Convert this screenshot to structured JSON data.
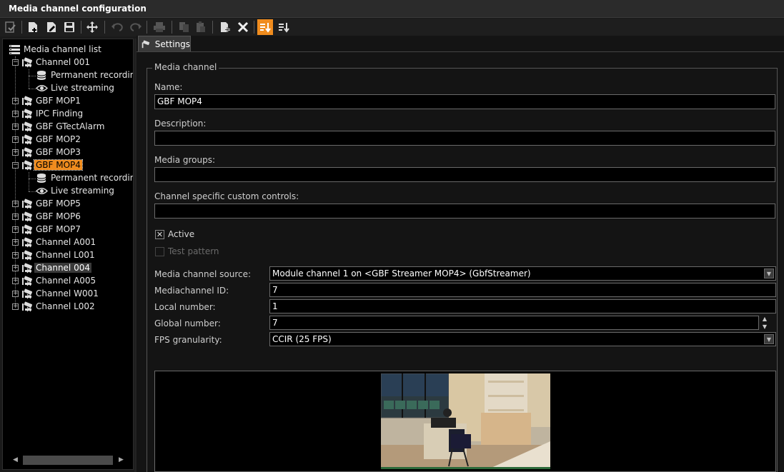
{
  "window": {
    "title": "Media channel configuration"
  },
  "toolbar": {
    "buttons": [
      {
        "icon": "check-config-icon"
      },
      {
        "icon": "new-icon"
      },
      {
        "icon": "edit-icon"
      },
      {
        "icon": "save-icon"
      },
      {
        "icon": "move-icon"
      },
      {
        "icon": "undo-icon"
      },
      {
        "icon": "redo-icon"
      },
      {
        "icon": "print-icon"
      },
      {
        "icon": "copy-icon"
      },
      {
        "icon": "paste-icon"
      },
      {
        "icon": "add-icon"
      },
      {
        "icon": "delete-icon"
      },
      {
        "icon": "sort-icon"
      },
      {
        "icon": "sort-alt-icon"
      }
    ],
    "accent": "#f08c1e"
  },
  "tree": {
    "root": "Media channel list",
    "items": [
      {
        "label": "Channel 001"
      },
      {
        "label": "Permanent recordin"
      },
      {
        "label": "Live streaming"
      },
      {
        "label": "GBF MOP1"
      },
      {
        "label": "IPC Finding"
      },
      {
        "label": "GBF GTectAlarm"
      },
      {
        "label": "GBF MOP2"
      },
      {
        "label": "GBF MOP3"
      },
      {
        "label": "GBF MOP4"
      },
      {
        "label": "Permanent recordin"
      },
      {
        "label": "Live streaming"
      },
      {
        "label": "GBF MOP5"
      },
      {
        "label": "GBF MOP6"
      },
      {
        "label": "GBF MOP7"
      },
      {
        "label": "Channel A001"
      },
      {
        "label": "Channel L001"
      },
      {
        "label": "Channel 004"
      },
      {
        "label": "Channel A005"
      },
      {
        "label": "Channel W001"
      },
      {
        "label": "Channel L002"
      }
    ],
    "selected": "GBF MOP4"
  },
  "settings": {
    "tab_label": "Settings",
    "group_title": "Media channel",
    "name_label": "Name:",
    "name_value": "GBF MOP4",
    "description_label": "Description:",
    "description_value": "",
    "media_groups_label": "Media groups:",
    "media_groups_value": "",
    "custom_controls_label": "Channel specific custom controls:",
    "custom_controls_value": "",
    "active_label": "Active",
    "active_checked": "✕",
    "test_pattern_label": "Test pattern",
    "source_label": "Media channel source:",
    "source_value": "Module channel 1 on <GBF Streamer MOP4> (GbfStreamer)",
    "id_label": "Mediachannel ID:",
    "id_value": "7",
    "local_label": "Local number:",
    "local_value": "1",
    "global_label": "Global number:",
    "global_value": "7",
    "fps_label": "FPS granularity:",
    "fps_value": "CCIR (25 FPS)"
  }
}
